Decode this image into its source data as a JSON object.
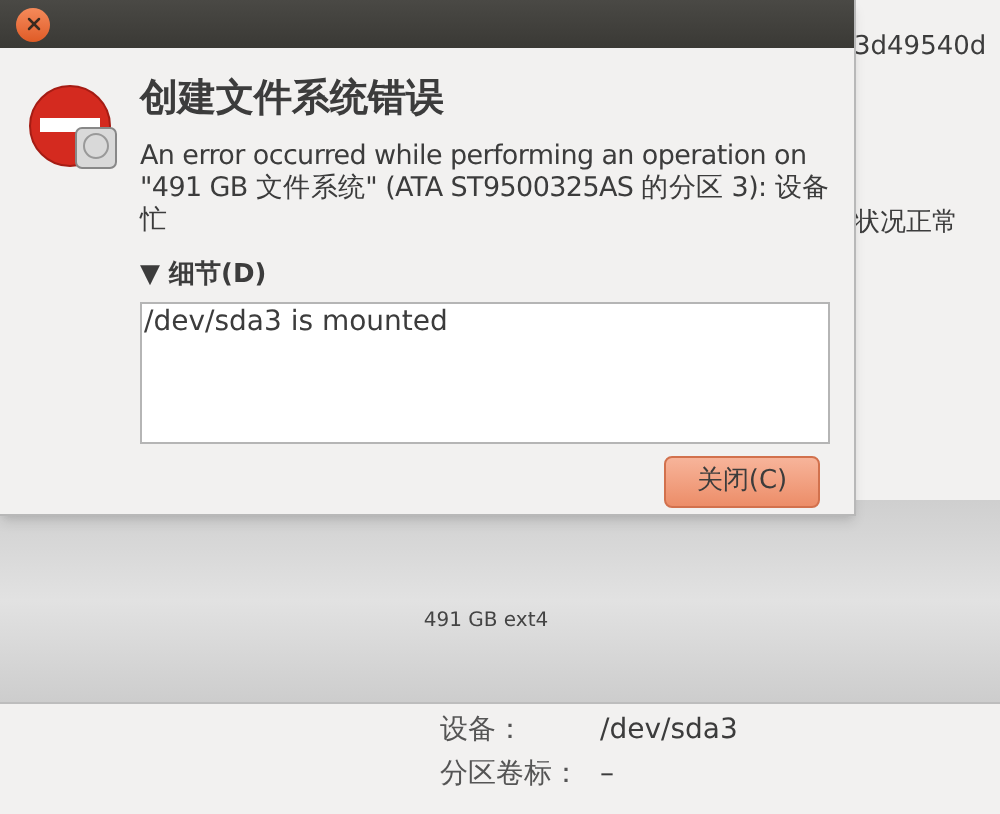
{
  "background": {
    "side_texts": [
      "3d49540d",
      "状况正常"
    ],
    "partition": {
      "label": "491 GB ext4"
    },
    "details": [
      {
        "label": "设备：",
        "value": "/dev/sda3"
      },
      {
        "label": "分区卷标：",
        "value": "–"
      }
    ]
  },
  "dialog": {
    "heading": "创建文件系统错误",
    "message": "An error occurred while performing an operation on \"491 GB 文件系统\" (ATA ST9500325AS 的分区 3): 设备忙",
    "details_toggle": {
      "label": "▼ 细节(D)",
      "expanded": true
    },
    "details_text": "/dev/sda3 is mounted",
    "buttons": [
      "关闭(C)"
    ]
  }
}
